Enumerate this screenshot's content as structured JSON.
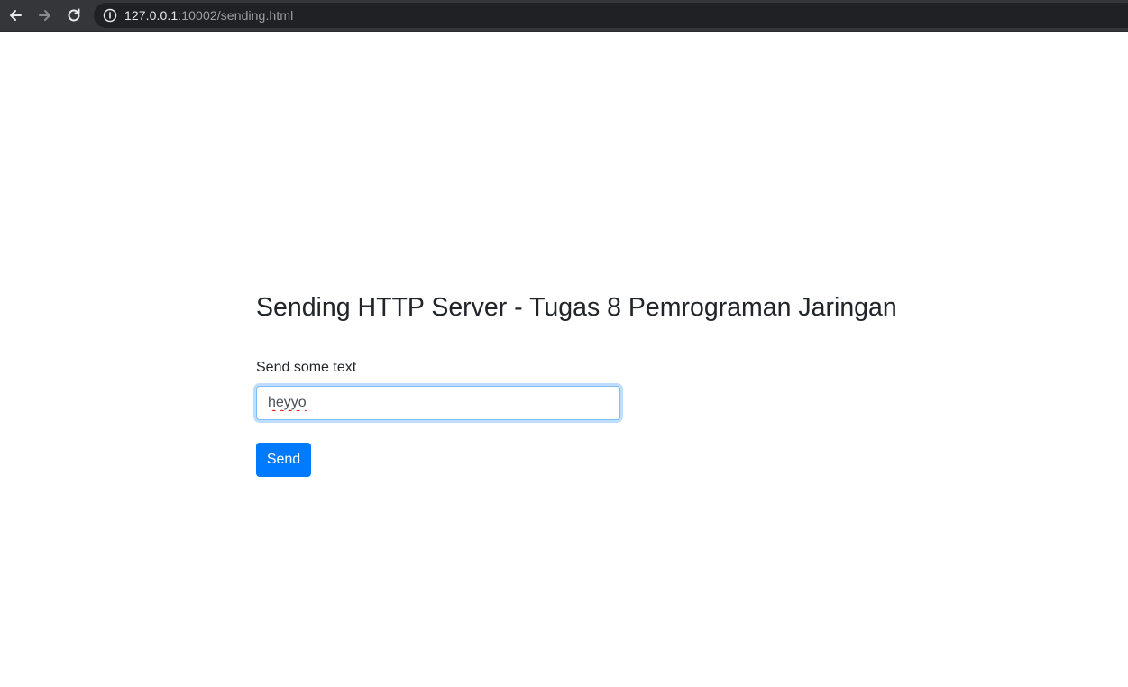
{
  "browser": {
    "url_host": "127.0.0.1",
    "url_rest": ":10002/sending.html",
    "icons": {
      "back": "arrow-left",
      "forward": "arrow-right",
      "reload": "reload",
      "site_info": "info-circle"
    }
  },
  "page": {
    "title": "Sending HTTP Server - Tugas 8 Pemrograman Jaringan",
    "form": {
      "label": "Send some text",
      "input_value": "heyyo",
      "button_label": "Send"
    }
  },
  "colors": {
    "toolbar": "#35363a",
    "omnibox": "#202124",
    "primary_button": "#007bff",
    "focus_border": "#80bdff",
    "text": "#212529"
  }
}
